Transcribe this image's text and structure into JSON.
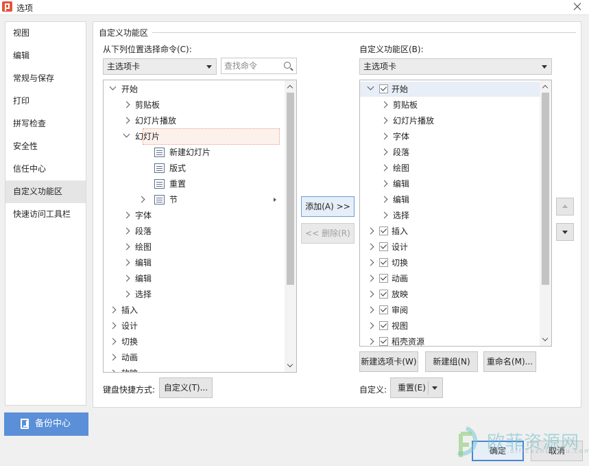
{
  "window": {
    "title": "选项"
  },
  "nav": {
    "items": [
      "视图",
      "编辑",
      "常规与保存",
      "打印",
      "拼写检查",
      "安全性",
      "信任中心",
      "自定义功能区",
      "快速访问工具栏"
    ],
    "active_index": 7
  },
  "backup": {
    "label": "备份中心"
  },
  "group": {
    "title": "自定义功能区"
  },
  "left": {
    "choose_label": "从下列位置选择命令(C):",
    "dropdown_value": "主选项卡",
    "search_placeholder": "查找命令",
    "tree": [
      {
        "text": "开始",
        "level": 0,
        "state": "expanded"
      },
      {
        "text": "剪贴板",
        "level": 1,
        "state": "collapsed"
      },
      {
        "text": "幻灯片播放",
        "level": 1,
        "state": "collapsed"
      },
      {
        "text": "幻灯片",
        "level": 1,
        "state": "expanded",
        "highlight": true
      },
      {
        "text": "新建幻灯片",
        "level": 2,
        "state": "leaf",
        "icon": "new-slide-icon"
      },
      {
        "text": "版式",
        "level": 2,
        "state": "leaf",
        "icon": "layout-icon"
      },
      {
        "text": "重置",
        "level": 2,
        "state": "leaf",
        "icon": "reset-icon"
      },
      {
        "text": "节",
        "level": 2,
        "state": "collapsed",
        "icon": "section-icon",
        "submenu": true
      },
      {
        "text": "字体",
        "level": 1,
        "state": "collapsed"
      },
      {
        "text": "段落",
        "level": 1,
        "state": "collapsed"
      },
      {
        "text": "绘图",
        "level": 1,
        "state": "collapsed"
      },
      {
        "text": "编辑",
        "level": 1,
        "state": "collapsed"
      },
      {
        "text": "编辑",
        "level": 1,
        "state": "collapsed"
      },
      {
        "text": "选择",
        "level": 1,
        "state": "collapsed"
      },
      {
        "text": "插入",
        "level": 0,
        "state": "collapsed"
      },
      {
        "text": "设计",
        "level": 0,
        "state": "collapsed"
      },
      {
        "text": "切换",
        "level": 0,
        "state": "collapsed"
      },
      {
        "text": "动画",
        "level": 0,
        "state": "collapsed"
      },
      {
        "text": "放映",
        "level": 0,
        "state": "collapsed",
        "clipped": true
      }
    ],
    "keyboard_label": "键盘快捷方式:",
    "keyboard_button": "自定义(T)..."
  },
  "middle": {
    "add_button": "添加(A) >>",
    "remove_button": "<< 删除(R)"
  },
  "right": {
    "ribbon_label": "自定义功能区(B):",
    "dropdown_value": "主选项卡",
    "tree": [
      {
        "text": "开始",
        "level": 0,
        "state": "expanded",
        "checked": true,
        "selected": true
      },
      {
        "text": "剪贴板",
        "level": 1,
        "state": "collapsed"
      },
      {
        "text": "幻灯片播放",
        "level": 1,
        "state": "collapsed"
      },
      {
        "text": "字体",
        "level": 1,
        "state": "collapsed"
      },
      {
        "text": "段落",
        "level": 1,
        "state": "collapsed"
      },
      {
        "text": "绘图",
        "level": 1,
        "state": "collapsed"
      },
      {
        "text": "编辑",
        "level": 1,
        "state": "collapsed"
      },
      {
        "text": "编辑",
        "level": 1,
        "state": "collapsed"
      },
      {
        "text": "选择",
        "level": 1,
        "state": "collapsed"
      },
      {
        "text": "插入",
        "level": 0,
        "state": "collapsed",
        "checked": true
      },
      {
        "text": "设计",
        "level": 0,
        "state": "collapsed",
        "checked": true
      },
      {
        "text": "切换",
        "level": 0,
        "state": "collapsed",
        "checked": true
      },
      {
        "text": "动画",
        "level": 0,
        "state": "collapsed",
        "checked": true
      },
      {
        "text": "放映",
        "level": 0,
        "state": "collapsed",
        "checked": true
      },
      {
        "text": "审阅",
        "level": 0,
        "state": "collapsed",
        "checked": true
      },
      {
        "text": "视图",
        "level": 0,
        "state": "collapsed",
        "checked": true
      },
      {
        "text": "稻壳资源",
        "level": 0,
        "state": "collapsed",
        "checked": true
      }
    ],
    "new_tab_button": "新建选项卡(W)",
    "new_group_button": "新建组(N)",
    "rename_button": "重命名(M)...",
    "customize_label": "自定义:",
    "reset_button": "重置(E)"
  },
  "footer": {
    "ok_button": "确定",
    "cancel_button": "取消"
  },
  "watermark": {
    "text": "欧菲资源网",
    "url": "www.officezhushou.com"
  }
}
